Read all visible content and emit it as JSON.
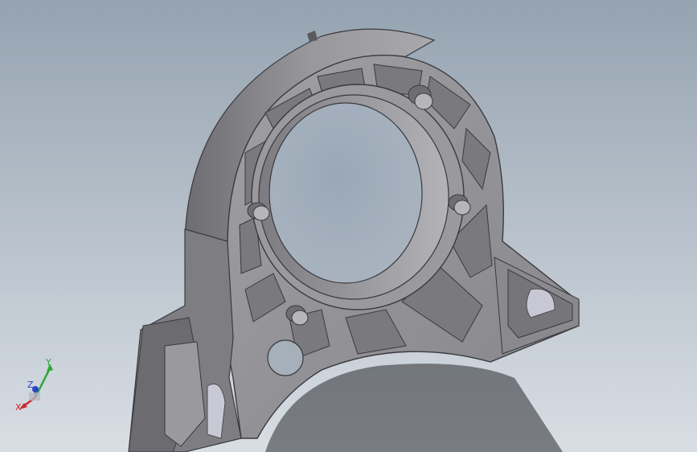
{
  "viewport": {
    "background_top": "#98a6b4",
    "background_bottom": "#d7dde3",
    "part_color": "#8f8f93"
  },
  "triad": {
    "icon": "xyz-axis-triad-icon",
    "x_label": "X",
    "y_label": "Y",
    "z_label": "Z",
    "x_color": "#d0262a",
    "y_color": "#2aa836",
    "z_color": "#2b44c8"
  }
}
